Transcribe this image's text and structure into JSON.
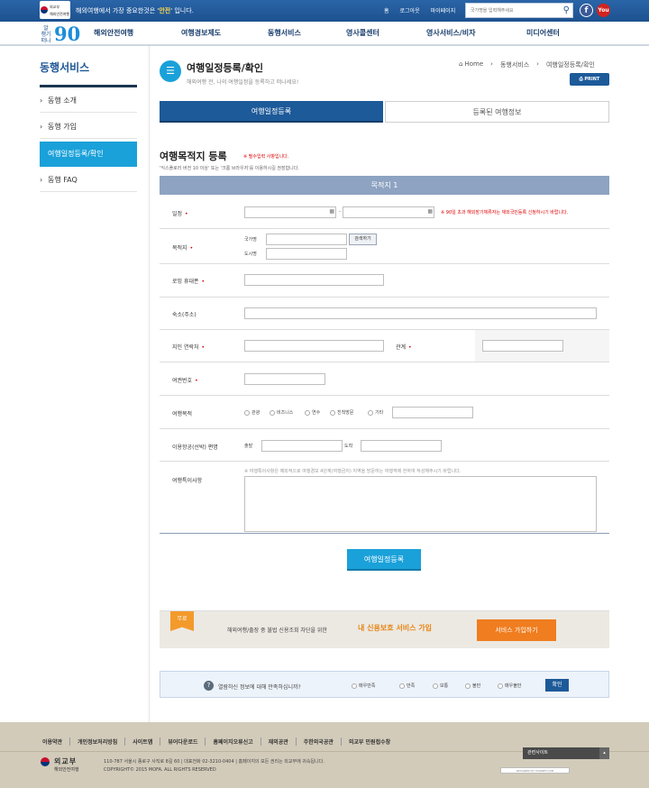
{
  "top": {
    "logo_label": "외교부",
    "logo_sub": "해외안전여행",
    "tagline_pre": "해외여행에서 가장 중요한것은 '",
    "tagline_highlight": "안전",
    "tagline_post": "' 입니다.",
    "links": [
      "홈",
      "로그아웃",
      "마이페이지"
    ],
    "search_placeholder": "국가명을 입력해주세요",
    "facebook": "f",
    "youtube": "You"
  },
  "brand": {
    "line1": "알",
    "line2": "챙기",
    "line3": "떠나",
    "num": "90"
  },
  "nav": [
    "해외안전여행",
    "여행경보제도",
    "동행서비스",
    "영사콜센터",
    "영사서비스/비자",
    "미디어센터"
  ],
  "sidebar": {
    "title": "동행서비스",
    "items": [
      "동행 소개",
      "동행 가입",
      "여행일정등록/확인",
      "동행 FAQ"
    ]
  },
  "page": {
    "title": "여행일정등록/확인",
    "subtitle": "해외여행 전, 나의 여행일정을 등록하고 떠나세요!",
    "breadcrumb": [
      "Home",
      "동행서비스",
      "여행일정등록/확인"
    ],
    "print": "PRINT",
    "tabs": [
      "여행일정등록",
      "등록된 여행정보"
    ]
  },
  "form": {
    "title": "여행목적지 등록",
    "required_note": "※ 필수입력 사항입니다.",
    "desc": "'익스플로러 버전 10 이상' 또는 '크롬 브라우저'를 이용하시길 권장합니다.",
    "dest_header": "목적지 1",
    "schedule": {
      "label": "일정",
      "sep": "-",
      "note": "※ 90일 초과 해외장기체류자는 재외국민등록 신청하시기 바랍니다."
    },
    "destination": {
      "label": "목적지",
      "country": "국가명",
      "city": "도시명",
      "search": "검색하기"
    },
    "roaming": {
      "label": "로밍 휴대폰"
    },
    "lodging": {
      "label": "숙소(주소)"
    },
    "contact": {
      "label": "지인 연락처",
      "relation": "관계"
    },
    "passport": {
      "label": "여권번호"
    },
    "purpose": {
      "label": "여행목적",
      "options": [
        "관광",
        "비즈니스",
        "연수",
        "친척방문",
        "기타"
      ]
    },
    "flight": {
      "label": "이용항공(선박) 편명",
      "depart": "출발",
      "arrive": "도착"
    },
    "notes": {
      "label": "여행특이사항",
      "hint": "※ 여행특이사항은 예외적으로 여행경보 4단계(여행금지) 지역을 방문하는 여행객에 한하여 작성해주시기 바랍니다."
    },
    "submit": "여행일정등록"
  },
  "ad": {
    "badge": "무료",
    "text": "해외여행/출장 중 불법 신용조회 차단을 위한",
    "highlight": "내 신용보호 서비스 가입",
    "button": "서비스 가입하기"
  },
  "survey": {
    "icon": "?",
    "question": "열람하신 정보에 대해 만족하십니까?",
    "options": [
      "매우만족",
      "만족",
      "보통",
      "불만",
      "매우불만"
    ],
    "confirm": "확인"
  },
  "footer": {
    "links": [
      "이용약관",
      "개인정보처리방침",
      "사이트맵",
      "뷰어다운로드",
      "홈페이지오류신고",
      "재외공관",
      "주한외국공관",
      "외교부 민원접수창"
    ],
    "org": "외교부",
    "org_sub": "해외안전여행",
    "address": "110-787 서울시 종로구 사직로 8길 60  |  대표전화 02-3210-0404  |  홈페이지의 모든 권리는 외교부에 귀속됩니다.",
    "copyright": "COPYRIGHT© 2015 MOFA. ALL RIGHTS RESERVED",
    "related": "관련사이트",
    "designer": "DESIGNED BY HANNET.COM"
  }
}
